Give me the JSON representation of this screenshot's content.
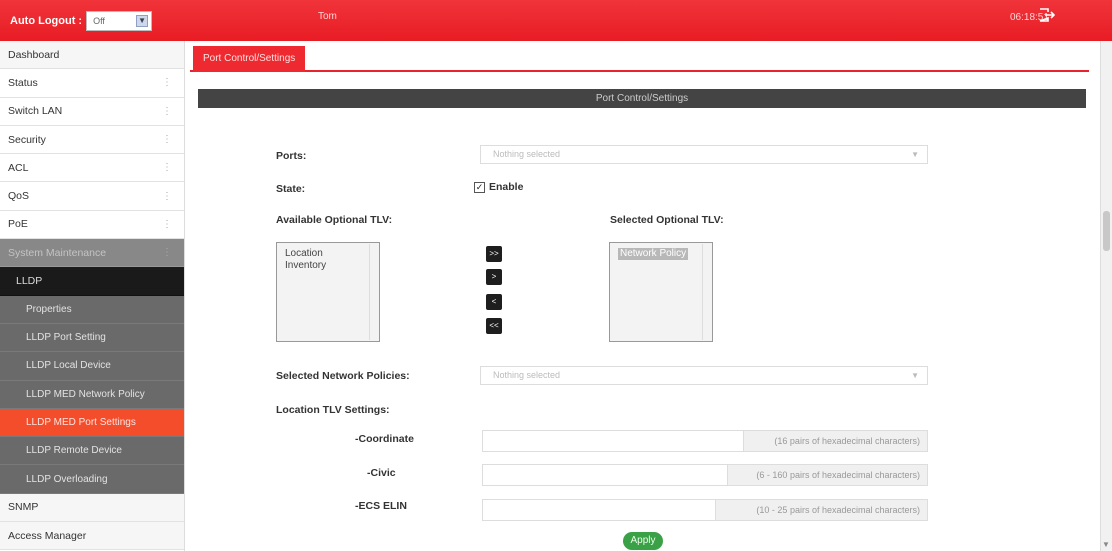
{
  "header": {
    "auto_logout_label": "Auto Logout :",
    "auto_logout_value": "Off",
    "user": "Tom",
    "clock": "06:18:51",
    "logout_icon": "logout-icon"
  },
  "sidebar": {
    "items": [
      {
        "label": "Dashboard"
      },
      {
        "label": "Status"
      },
      {
        "label": "Switch LAN"
      },
      {
        "label": "Security"
      },
      {
        "label": "ACL"
      },
      {
        "label": "QoS"
      },
      {
        "label": "PoE"
      },
      {
        "label": "System Maintenance"
      },
      {
        "label": "LLDP"
      },
      {
        "label": "Properties"
      },
      {
        "label": "LLDP Port Setting"
      },
      {
        "label": "LLDP Local Device"
      },
      {
        "label": "LLDP MED Network Policy"
      },
      {
        "label": "LLDP MED Port Settings"
      },
      {
        "label": "LLDP Remote Device"
      },
      {
        "label": "LLDP Overloading"
      },
      {
        "label": "SNMP"
      },
      {
        "label": "Access Manager"
      }
    ]
  },
  "tab": {
    "label": "Port Control/Settings"
  },
  "section": {
    "title": "Port Control/Settings"
  },
  "form": {
    "ports_label": "Ports:",
    "ports_placeholder": "Nothing selected",
    "state_label": "State:",
    "enable_label": "Enable",
    "enable_checked": true,
    "available_tlv_label": "Available Optional TLV:",
    "available_tlv_items": [
      "Location",
      "Inventory"
    ],
    "selected_tlv_label": "Selected Optional TLV:",
    "selected_tlv_items": [
      "Network Policy"
    ],
    "move_buttons": [
      ">>",
      ">",
      "<",
      "<<"
    ],
    "network_policies_label": "Selected Network Policies:",
    "network_policies_placeholder": "Nothing selected",
    "location_tlv_label": "Location TLV Settings:",
    "coordinate_label": "-Coordinate",
    "coordinate_hint": "(16 pairs of hexadecimal characters)",
    "civic_label": "-Civic",
    "civic_hint": "(6 - 160 pairs of hexadecimal characters)",
    "ecs_label": "-ECS ELIN",
    "ecs_hint": "(10 - 25 pairs of hexadecimal characters)",
    "apply_label": "Apply"
  },
  "colors": {
    "brand_red": "#e81c24",
    "active_item": "#f44d2c",
    "apply_green": "#3aa146"
  }
}
